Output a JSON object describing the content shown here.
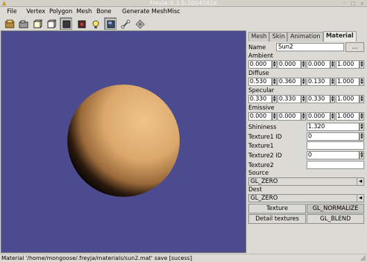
{
  "window": {
    "title": "Freyja-0.3.5-20040416",
    "minimize_glyph": "-",
    "maximize_glyph": "□",
    "close_glyph": "x"
  },
  "menu": [
    "File",
    "Vertex",
    "Polygon",
    "Mesh",
    "Bone",
    "Generate Mesh",
    "Misc"
  ],
  "toolbar": {
    "icons": [
      "new-file-icon",
      "open-folder-icon",
      "cube-outline-icon",
      "cube-select-icon",
      "solid-box-icon",
      "texture-box-icon",
      "light-bulb-icon",
      "material-view-icon",
      "bone-icon",
      "grid-mesh-icon"
    ]
  },
  "viewport": {
    "background": "#4d4b8f",
    "sphere_color": "#e0b27a"
  },
  "tabs": [
    "Mesh",
    "Skin",
    "Animation",
    "Material"
  ],
  "active_tab": "Material",
  "material": {
    "name_label": "Name",
    "name_value": "Sun2",
    "browse_label": "...",
    "ambient_label": "Ambient",
    "ambient": [
      "0.000",
      "0.000",
      "0.000",
      "1.000"
    ],
    "diffuse_label": "Diffuse",
    "diffuse": [
      "0.530",
      "0.360",
      "0.130",
      "1.000"
    ],
    "specular_label": "Specular",
    "specular": [
      "0.330",
      "0.330",
      "0.330",
      "1.000"
    ],
    "emissive_label": "Emissive",
    "emissive": [
      "0.000",
      "0.000",
      "0.000",
      "1.000"
    ],
    "shininess_label": "Shininess",
    "shininess": "1.320",
    "texture1_id_label": "Texture1 ID",
    "texture1_id": "0",
    "texture1_label": "Texture1",
    "texture1": "",
    "texture2_id_label": "Texture2 ID",
    "texture2_id": "0",
    "texture2_label": "Texture2",
    "texture2": "",
    "source_label": "Source",
    "source_value": "GL_ZERO",
    "dest_label": "Dest",
    "dest_value": "GL_ZERO",
    "texture_btn": "Texture",
    "normalize_btn": "GL_NORMALIZE",
    "detail_btn": "Detail textures",
    "blend_btn": "GL_BLEND"
  },
  "status": "Material '/home/mongoose/.freyja/materials/sun2.mat' save [sucess]"
}
